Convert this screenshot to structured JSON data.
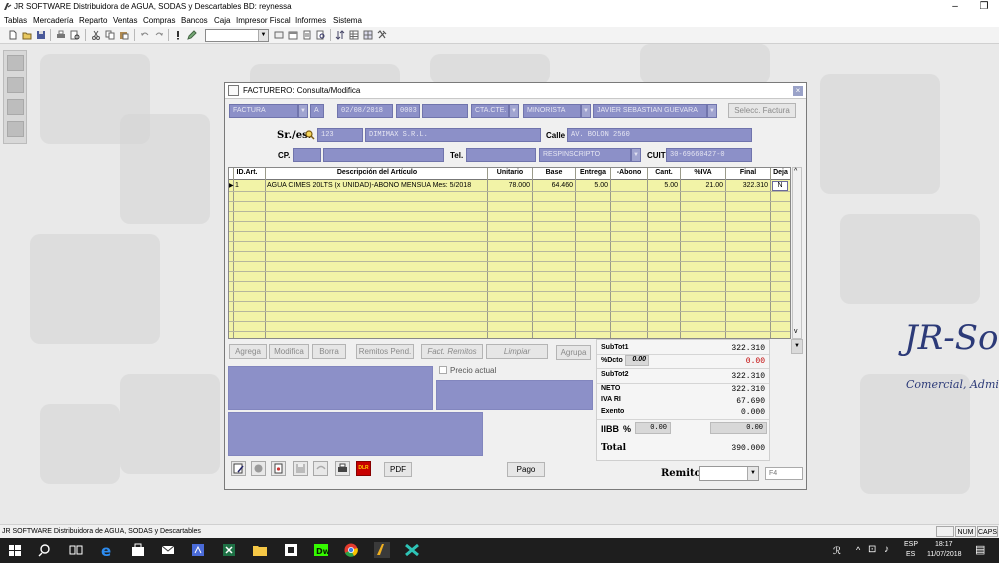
{
  "app": {
    "title": "JR SOFTWARE Distribuidora de AGUA, SODAS y Descartables BD: reynessa",
    "menu": [
      "Tablas",
      "Mercadería",
      "Reparto",
      "Ventas",
      "Compras",
      "Bancos",
      "Caja",
      "Impresor Fiscal",
      "Informes",
      "Sistema"
    ],
    "window_controls": {
      "minimize": "–",
      "restore": "❐"
    }
  },
  "background": {
    "brand": "JR-So",
    "brand_sub": "Comercial, Administr"
  },
  "form": {
    "title": "FACTURERO: Consulta/Modifica",
    "close": "×",
    "header": {
      "tipo": "FACTURA",
      "letra": "A",
      "fecha": "02/08/2018",
      "punto_venta": "0003",
      "numero": "",
      "condicion": "CTA.CTE.",
      "lista": "MINORISTA",
      "vendedor": "JAVIER SEBASTIAN GUEVARA",
      "select_invoice": "Selecc. Factura"
    },
    "cliente": {
      "label": "Sr./es:",
      "codigo": "123",
      "nombre": "DIMIMAX S.R.L.",
      "calle_label": "Calle",
      "calle": "AV. BOLON 2560",
      "cp_label": "CP.",
      "cp": "",
      "localidad": "",
      "tel_label": "Tel.",
      "tel": "",
      "iva": "RESPINSCRIPTO",
      "cuit_label": "CUIT",
      "cuit": "30-69660427-0"
    },
    "grid": {
      "columns": [
        "ID.Art.",
        "Descripción del Artículo",
        "Unitario",
        "Base",
        "Entrega",
        "-Abono",
        "Cant.",
        "%IVA",
        "Final",
        "Deja"
      ],
      "rows": [
        {
          "id": "1",
          "descripcion": "AGUA CIMES 20LTS (x UNIDAD)-ABONO MENSUA Mes: 5/2018",
          "unitario": "78.000",
          "base": "64.460",
          "entrega": "5.00",
          "abono": "",
          "cant": "5.00",
          "iva": "21.00",
          "final": "322.310",
          "deja": "N"
        }
      ]
    },
    "buttons": {
      "agrega": "Agrega",
      "modifica": "Modifica",
      "borra": "Borra",
      "remitos_pend": "Remitos Pend.",
      "fact_remitos": "Fact. Remitos",
      "limpiar": "Limpiar",
      "agrupa": "Agrupa",
      "pdf": "PDF",
      "pago": "Pago"
    },
    "precio_actual": "Precio actual",
    "totals": {
      "subtot1_label": "SubTot1",
      "subtot1": "322.310",
      "dcto_label": "%Dcto",
      "dcto_pct": "0.00",
      "dcto": "0.00",
      "subtot2_label": "SubTot2",
      "subtot2": "322.310",
      "neto_label": "NETO",
      "neto": "322.310",
      "ivari_label": "IVA RI",
      "ivari": "67.690",
      "exento_label": "Exento",
      "exento": "0.000",
      "iibb_label": "IIBB",
      "iibb_pct_sign": "%",
      "iibb_pct": "0.00",
      "iibb": "0.00",
      "total_label": "Total",
      "total": "390.000"
    },
    "remitos_label": "Remitos",
    "f4": "F4",
    "icon_dlr": "DLR"
  },
  "statusbar": {
    "text": "JR SOFTWARE Distribuidora de AGUA, SODAS y Descartables",
    "num": "NUM",
    "caps": "CAPS"
  },
  "taskbar": {
    "lang1": "ESP",
    "lang2": "ES",
    "time": "18:17",
    "date": "11/07/2018",
    "user": "ℛ"
  },
  "colors": {
    "field": "#8c90c8",
    "grid": "#f2f3a7",
    "accent_red": "#c00000",
    "brand": "#2c3a78"
  }
}
